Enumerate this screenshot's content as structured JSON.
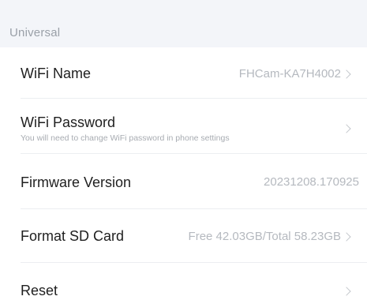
{
  "section": {
    "title": "Universal"
  },
  "rows": [
    {
      "title": "WiFi Name",
      "value": "FHCam-KA7H4002",
      "chevron": true
    },
    {
      "title": "WiFi Password",
      "subtitle": "You will need to change WiFi password in phone settings",
      "chevron": true
    },
    {
      "title": "Firmware Version",
      "value": "20231208.170925",
      "chevron": false
    },
    {
      "title": "Format SD Card",
      "value": "Free 42.03GB/Total 58.23GB",
      "chevron": true
    },
    {
      "title": "Reset",
      "chevron": true
    }
  ],
  "icons": {
    "chevron": "chevron-right-icon"
  },
  "colors": {
    "header_bg": "#f3f5f9",
    "value_text": "#b5b9bf",
    "title_text": "#1f1f1f"
  }
}
